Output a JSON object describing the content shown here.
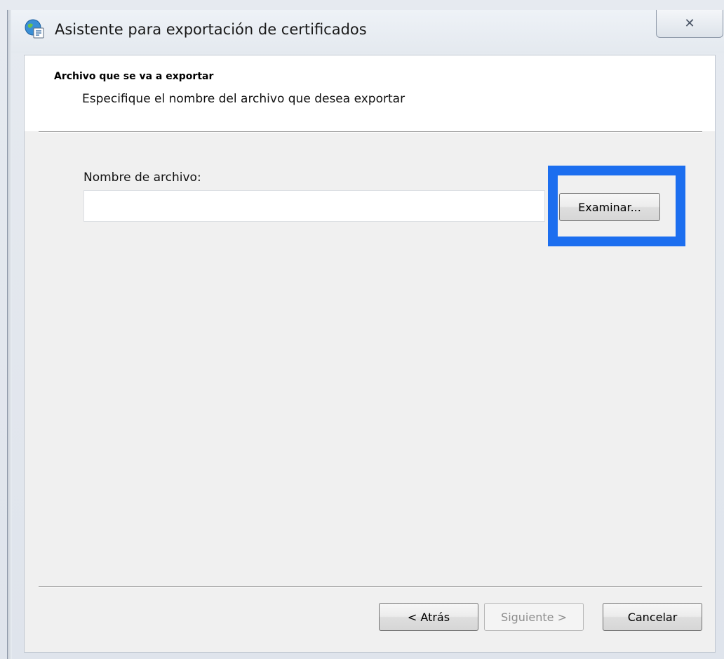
{
  "window": {
    "title": "Asistente para exportación de certificados",
    "close_label": "✕",
    "icon": "certificate-globe-icon"
  },
  "header": {
    "title": "Archivo que se va a exportar",
    "subtitle": "Especifique el nombre del archivo que desea exportar"
  },
  "form": {
    "filename_label": "Nombre de archivo:",
    "filename_value": "",
    "browse_label": "Examinar..."
  },
  "footer": {
    "back_label": "< Atrás",
    "next_label": "Siguiente >",
    "cancel_label": "Cancelar"
  },
  "colors": {
    "highlight": "#1c6eef"
  }
}
